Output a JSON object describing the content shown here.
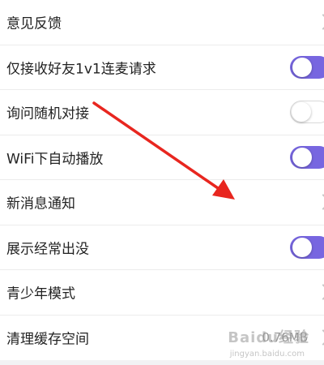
{
  "settings": {
    "rows": [
      {
        "label": "意见反馈",
        "control": "chevron"
      },
      {
        "label": "仅接收好友1v1连麦请求",
        "control": "toggle",
        "on": true
      },
      {
        "label": "询问随机对接",
        "control": "toggle",
        "on": false
      },
      {
        "label": "WiFi下自动播放",
        "control": "toggle",
        "on": true
      },
      {
        "label": "新消息通知",
        "control": "chevron"
      },
      {
        "label": "展示经常出没",
        "control": "toggle",
        "on": true
      },
      {
        "label": "青少年模式",
        "control": "chevron"
      },
      {
        "label": "清理缓存空间",
        "control": "value",
        "value": "0.76MB"
      }
    ]
  },
  "colors": {
    "toggle_on": "#7766e0",
    "annotation_arrow": "#e8261f"
  },
  "watermark": {
    "text": "Baidu经验",
    "sub": "jingyan.baidu.com"
  }
}
